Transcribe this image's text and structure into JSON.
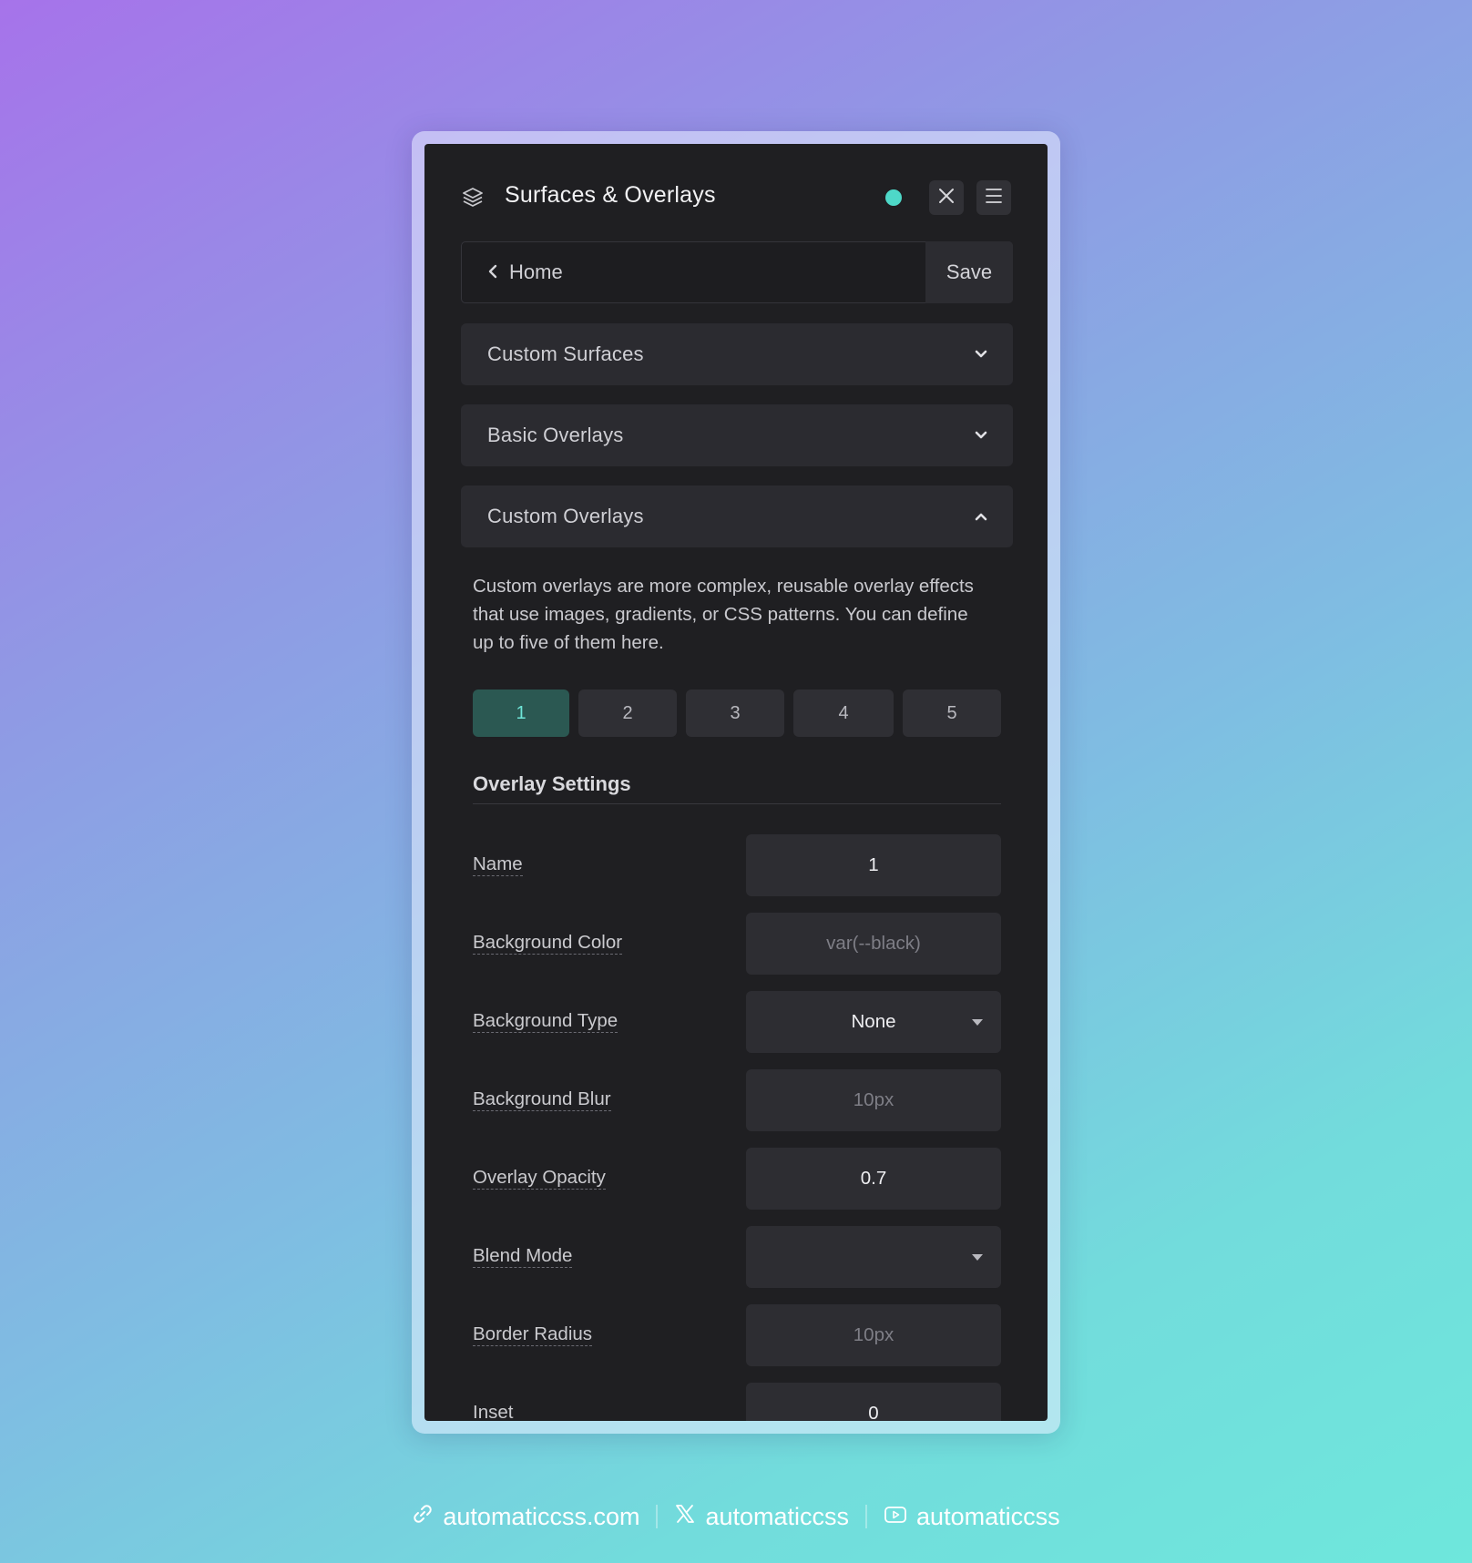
{
  "panel": {
    "title": "Surfaces & Overlays",
    "status_color": "#4ed8c8",
    "accent_color": "#6fe6d8"
  },
  "nav": {
    "back_label": "Home",
    "save_label": "Save"
  },
  "accordions": [
    {
      "label": "Custom Surfaces",
      "expanded": false
    },
    {
      "label": "Basic Overlays",
      "expanded": false
    },
    {
      "label": "Custom Overlays",
      "expanded": true
    }
  ],
  "custom_overlays": {
    "description": "Custom overlays are more complex, reusable overlay effects that use images, gradients, or CSS patterns. You can define up to five of them here.",
    "tabs": [
      "1",
      "2",
      "3",
      "4",
      "5"
    ],
    "active_tab": "1",
    "section_title": "Overlay Settings",
    "settings": [
      {
        "label": "Name",
        "value": "1",
        "placeholder": ""
      },
      {
        "label": "Background Color",
        "value": "",
        "placeholder": "var(--black)"
      },
      {
        "label": "Background Type",
        "value": "None",
        "placeholder": ""
      },
      {
        "label": "Background Blur",
        "value": "",
        "placeholder": "10px"
      },
      {
        "label": "Overlay Opacity",
        "value": "0.7",
        "placeholder": ""
      },
      {
        "label": "Blend Mode",
        "value": "",
        "placeholder": ""
      },
      {
        "label": "Border Radius",
        "value": "",
        "placeholder": "10px"
      },
      {
        "label": "Inset",
        "value": "0",
        "placeholder": ""
      }
    ]
  },
  "footer": {
    "website": "automaticcss.com",
    "x_handle": "automaticcss",
    "youtube_handle": "automaticcss"
  }
}
